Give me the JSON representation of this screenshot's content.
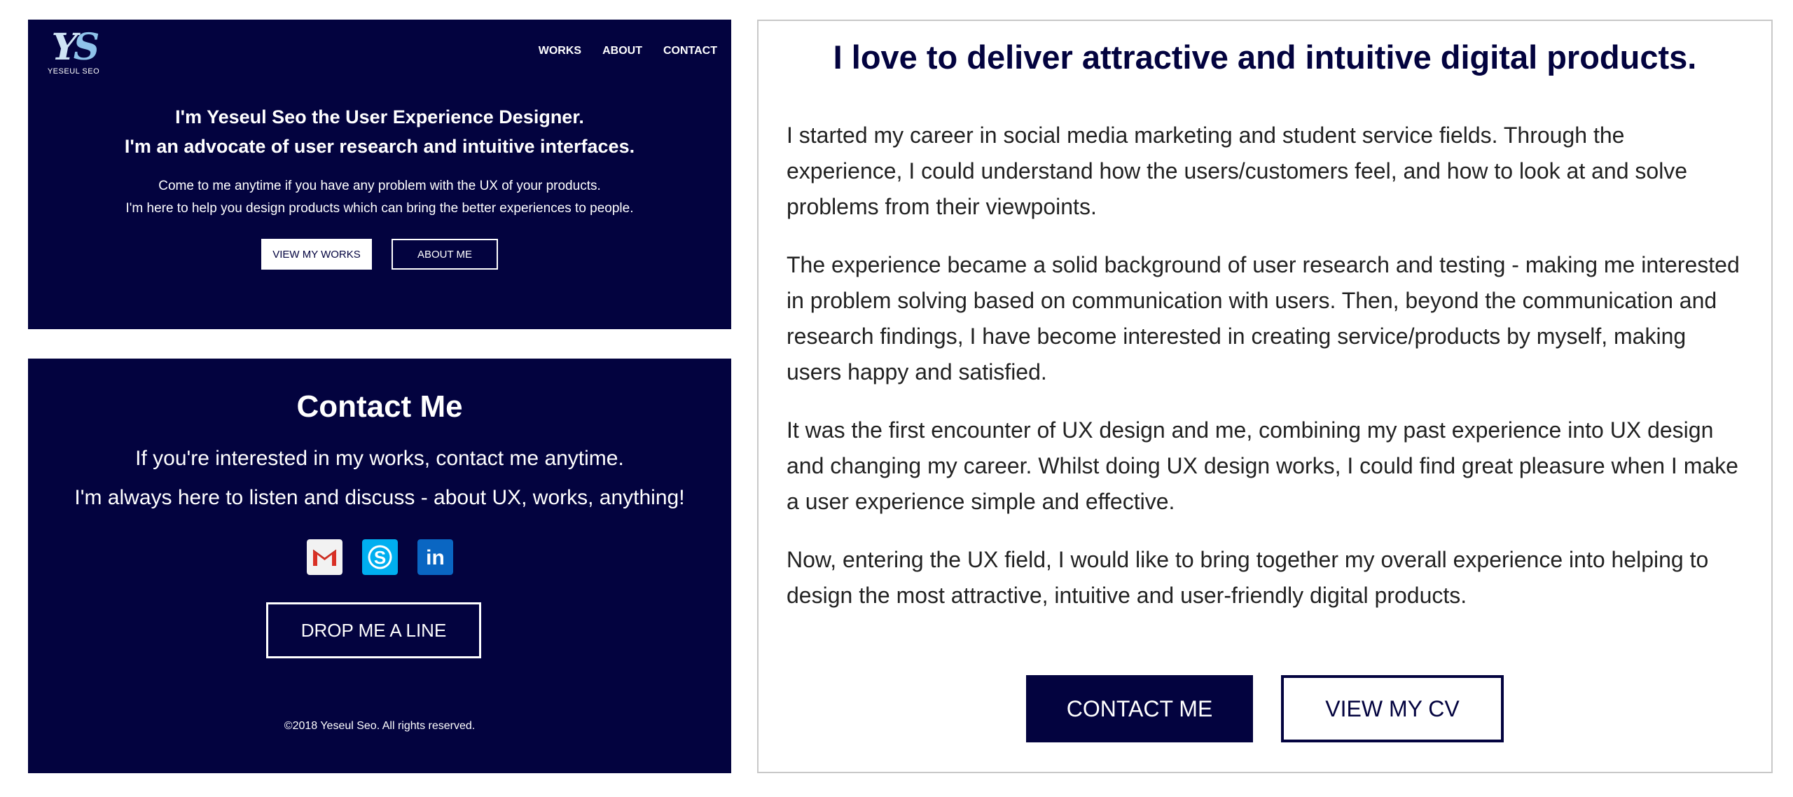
{
  "colors": {
    "navy": "#03033f",
    "white": "#ffffff",
    "panel_border": "#c8c8c8"
  },
  "hero": {
    "logo_mark": "YS",
    "logo_text": "YESEUL SEO",
    "nav": [
      "WORKS",
      "ABOUT",
      "CONTACT"
    ],
    "title_line1": "I'm Yeseul Seo the User Experience Designer.",
    "title_line2": "I'm an advocate of user research and intuitive interfaces.",
    "sub_line1": "Come to me anytime if you have any problem with the UX of your products.",
    "sub_line2": "I'm here to help you design products which can bring the better experiences to people.",
    "btn_works": "VIEW MY WORKS",
    "btn_about": "ABOUT ME"
  },
  "contact": {
    "title": "Contact Me",
    "line1": "If you're interested in my works, contact me anytime.",
    "line2": "I'm always here to listen and discuss - about UX, works, anything!",
    "icons": [
      "gmail-icon",
      "skype-icon",
      "linkedin-icon"
    ],
    "drop_button": "DROP ME A LINE",
    "footer": "©2018 Yeseul Seo. All rights reserved."
  },
  "about": {
    "title": "I love to deliver attractive and intuitive digital products.",
    "paragraphs": [
      "I started my career in social media marketing and student service fields. Through the experience, I could understand how the users/customers feel, and how to look at and solve problems from their viewpoints.",
      "The experience became a solid background of user research and testing - making me interested in problem solving based on communication with users. Then, beyond the communication and research findings, I have become interested in creating service/products by myself, making users happy and satisfied.",
      "It was the first encounter of UX design and me, combining my past experience into UX design and changing my career. Whilst doing UX design works, I could find great pleasure when I make a user experience simple and effective.",
      "Now, entering the UX field, I would like to bring together my overall experience into helping to design the most attractive, intuitive and user-friendly digital products."
    ],
    "btn_contact": "CONTACT ME",
    "btn_cv": "VIEW MY CV"
  }
}
